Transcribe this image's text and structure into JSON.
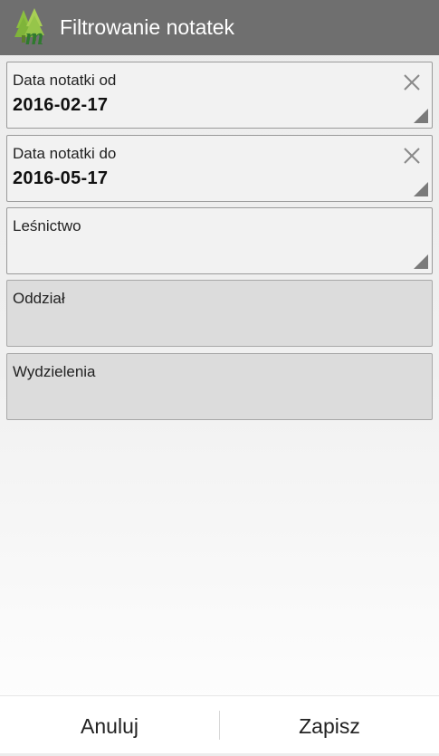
{
  "app": {
    "title": "Filtrowanie notatek",
    "logo_icon": "forest-m-logo",
    "header_color": "#6f6f6f"
  },
  "fields": {
    "date_from": {
      "label": "Data notatki od",
      "value": "2016-02-17",
      "clear_icon": "close-icon",
      "dropdown_icon": "spinner-corner-icon"
    },
    "date_to": {
      "label": "Data notatki do",
      "value": "2016-05-17",
      "clear_icon": "close-icon",
      "dropdown_icon": "spinner-corner-icon"
    },
    "forestry": {
      "label": "Leśnictwo",
      "value": "",
      "dropdown_icon": "spinner-corner-icon"
    },
    "division": {
      "label": "Oddział",
      "value": "",
      "enabled": false
    },
    "subdivisions": {
      "label": "Wydzielenia",
      "value": "",
      "enabled": false
    }
  },
  "actions": {
    "cancel_label": "Anuluj",
    "save_label": "Zapisz"
  }
}
